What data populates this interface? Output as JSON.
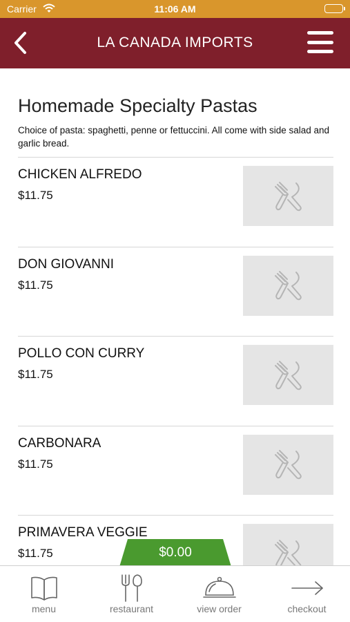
{
  "status_bar": {
    "carrier": "Carrier",
    "time": "11:06 AM"
  },
  "header": {
    "title": "LA CANADA IMPORTS"
  },
  "section": {
    "title": "Homemade Specialty Pastas",
    "description": "Choice of pasta: spaghetti, penne or fettuccini. All come with side salad and garlic bread."
  },
  "items": [
    {
      "name": "CHICKEN ALFREDO",
      "price": "$11.75"
    },
    {
      "name": "DON GIOVANNI",
      "price": "$11.75"
    },
    {
      "name": "POLLO CON CURRY",
      "price": "$11.75"
    },
    {
      "name": "CARBONARA",
      "price": "$11.75"
    },
    {
      "name": "PRIMAVERA VEGGIE",
      "price": "$11.75"
    }
  ],
  "order_total": "$0.00",
  "tabs": [
    {
      "label": "menu",
      "icon": "book-icon"
    },
    {
      "label": "restaurant",
      "icon": "fork-knife-icon"
    },
    {
      "label": "view order",
      "icon": "cloche-icon"
    },
    {
      "label": "checkout",
      "icon": "arrow-right-icon"
    }
  ],
  "colors": {
    "status_bar": "#d9962c",
    "header": "#7f1f2b",
    "total_tab": "#4a9a2f",
    "placeholder": "#e5e5e5"
  }
}
